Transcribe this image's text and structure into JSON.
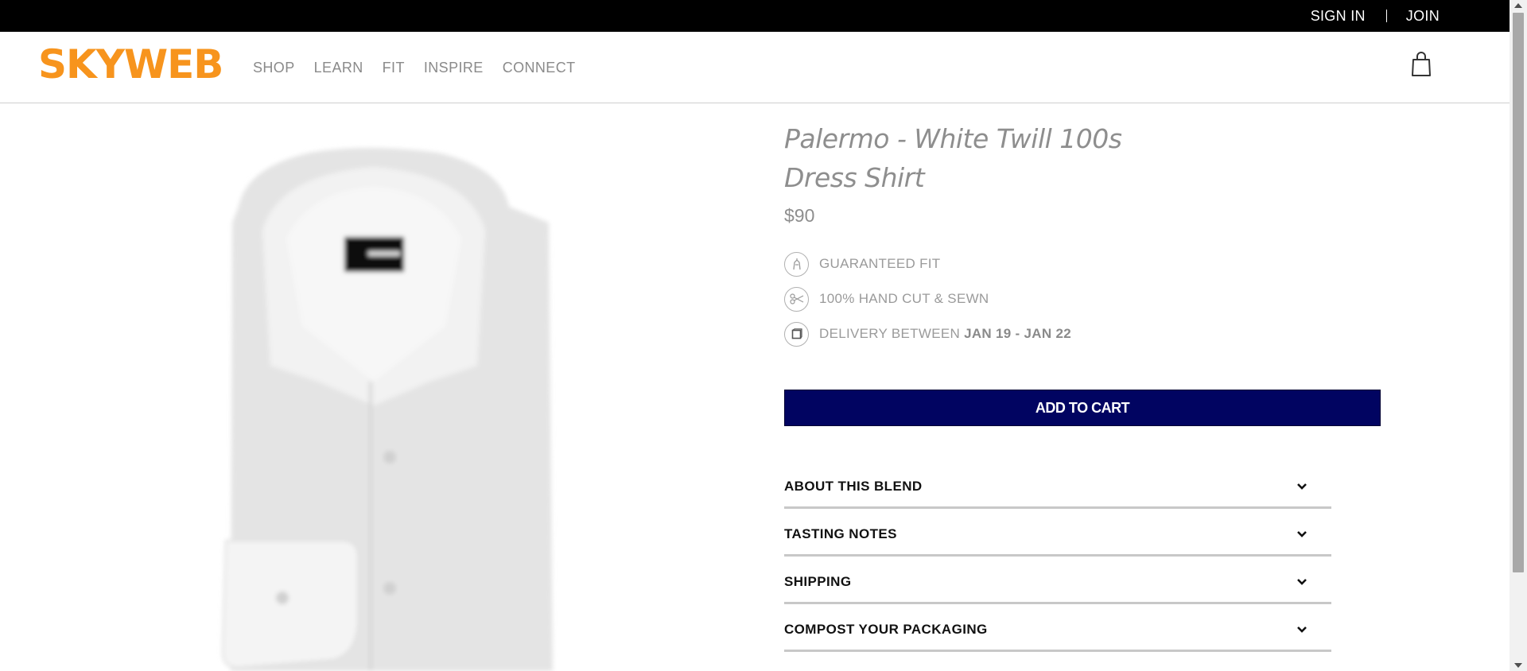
{
  "topbar": {
    "sign_in": "SIGN IN",
    "join": "JOIN"
  },
  "header": {
    "logo": "SKYWEB",
    "nav": [
      "SHOP",
      "LEARN",
      "FIT",
      "INSPIRE",
      "CONNECT"
    ],
    "cart_icon": "shopping-bag-icon"
  },
  "product": {
    "title_line1": "Palermo - White Twill 100s",
    "title_line2": "Dress Shirt",
    "price": "$90",
    "features": {
      "fit": {
        "icon": "fit-icon",
        "text": "GUARANTEED FIT"
      },
      "sewn": {
        "icon": "scissors-icon",
        "text": "100% HAND CUT & SEWN"
      },
      "delivery": {
        "icon": "box-icon",
        "prefix": "DELIVERY BETWEEN ",
        "dates": "JAN 19 - JAN 22"
      }
    },
    "add_to_cart": "ADD TO CART"
  },
  "accordion": [
    {
      "label": "ABOUT THIS BLEND"
    },
    {
      "label": "TASTING NOTES"
    },
    {
      "label": "SHIPPING"
    },
    {
      "label": "COMPOST YOUR PACKAGING"
    }
  ],
  "colors": {
    "brand": "#f7941d",
    "cta": "#010461",
    "topbar": "#000000"
  }
}
